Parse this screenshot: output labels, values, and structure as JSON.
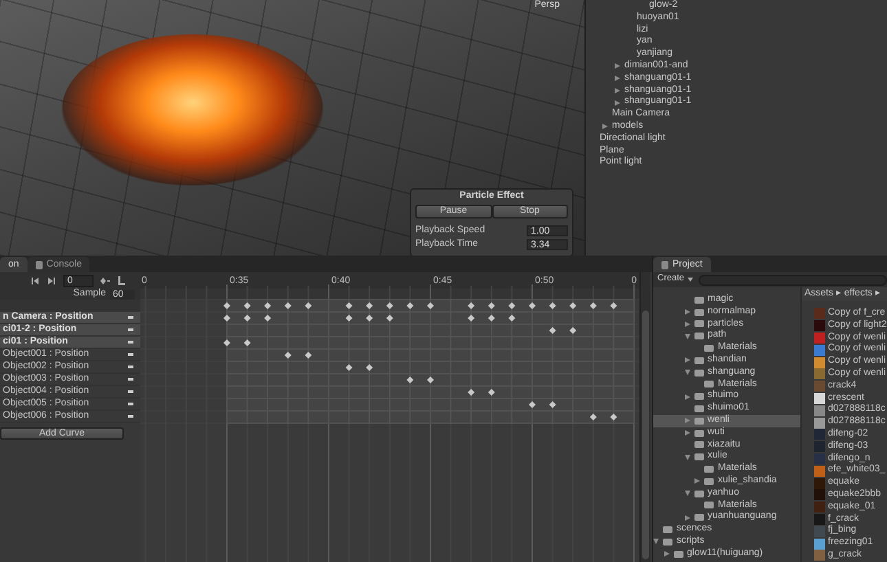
{
  "scene": {
    "view_label": "Persp"
  },
  "particle_effect": {
    "title": "Particle Effect",
    "buttons": [
      "Pause",
      "Stop"
    ],
    "fields": [
      {
        "label": "Playback Speed",
        "value": "1.00"
      },
      {
        "label": "Playback Time",
        "value": "3.34"
      }
    ]
  },
  "hierarchy": {
    "items": [
      {
        "children": [
          {
            "children": [
              {
                "children": [
                  {
                    "children": [
                      {
                        "label": "glow-2",
                        "selected": false
                      }
                    ]
                  },
                  {
                    "label": "huoyan01",
                    "selected": false
                  },
                  {
                    "label": "lizi",
                    "selected": false
                  },
                  {
                    "label": "yan",
                    "selected": false
                  },
                  {
                    "label": "yanjiang",
                    "selected": false
                  }
                ]
              },
              {
                "label": "dimian001-and",
                "expanded": false,
                "selected": false
              },
              {
                "label": "shanguang01-1",
                "expanded": false,
                "selected": false
              },
              {
                "label": "shanguang01-1",
                "expanded": false,
                "selected": false
              },
              {
                "label": "shanguang01-1",
                "expanded": false,
                "selected": false
              }
            ]
          },
          {
            "label": "Main Camera",
            "selected": false
          },
          {
            "label": "models",
            "expanded": false,
            "selected": false
          }
        ]
      },
      {
        "label": "Directional light",
        "selected": false
      },
      {
        "label": "Plane",
        "selected": false
      },
      {
        "label": "Point light",
        "selected": false
      }
    ]
  },
  "animation": {
    "tabs": [
      {
        "label": "on",
        "selected": true,
        "kind": "plain"
      },
      {
        "label": "Console",
        "selected": false,
        "kind": "console"
      }
    ],
    "frame": "0",
    "sample_label": "Sample",
    "sample": "60",
    "ruler": [
      "0",
      "0:35",
      "0:40",
      "0:45",
      "0:50",
      "0"
    ],
    "summary_keys": [
      true,
      true,
      true,
      true,
      true,
      false,
      true,
      true,
      true,
      true,
      true,
      false,
      true,
      true,
      true,
      true,
      true,
      true,
      true,
      true
    ],
    "tracks": [
      {
        "label": "n Camera : Position",
        "highlighted": true,
        "keys": [
          true,
          true,
          true,
          false,
          false,
          false,
          true,
          true,
          true,
          false,
          false,
          false,
          true,
          true,
          true,
          false,
          false,
          false,
          false,
          false
        ]
      },
      {
        "label": "ci01-2 : Position",
        "highlighted": true,
        "keys": [
          false,
          false,
          false,
          false,
          false,
          false,
          false,
          false,
          false,
          false,
          false,
          false,
          false,
          false,
          false,
          false,
          true,
          true,
          false,
          false
        ]
      },
      {
        "label": "ci01 : Position",
        "highlighted": true,
        "keys": [
          true,
          true,
          false,
          false,
          false,
          false,
          false,
          false,
          false,
          false,
          false,
          false,
          false,
          false,
          false,
          false,
          false,
          false,
          false,
          false
        ]
      },
      {
        "label": "Object001 : Position",
        "highlighted": false,
        "keys": [
          false,
          false,
          false,
          true,
          true,
          false,
          false,
          false,
          false,
          false,
          false,
          false,
          false,
          false,
          false,
          false,
          false,
          false,
          false,
          false
        ]
      },
      {
        "label": "Object002 : Position",
        "highlighted": false,
        "keys": [
          false,
          false,
          false,
          false,
          false,
          false,
          true,
          true,
          false,
          false,
          false,
          false,
          false,
          false,
          false,
          false,
          false,
          false,
          false,
          false
        ]
      },
      {
        "label": "Object003 : Position",
        "highlighted": false,
        "keys": [
          false,
          false,
          false,
          false,
          false,
          false,
          false,
          false,
          false,
          true,
          true,
          false,
          false,
          false,
          false,
          false,
          false,
          false,
          false,
          false
        ]
      },
      {
        "label": "Object004 : Position",
        "highlighted": false,
        "keys": [
          false,
          false,
          false,
          false,
          false,
          false,
          false,
          false,
          false,
          false,
          false,
          false,
          true,
          true,
          false,
          false,
          false,
          false,
          false,
          false
        ]
      },
      {
        "label": "Object005 : Position",
        "highlighted": false,
        "keys": [
          false,
          false,
          false,
          false,
          false,
          false,
          false,
          false,
          false,
          false,
          false,
          false,
          false,
          false,
          false,
          true,
          true,
          false,
          false,
          false
        ]
      },
      {
        "label": "Object006 : Position",
        "highlighted": false,
        "keys": [
          false,
          false,
          false,
          false,
          false,
          false,
          false,
          false,
          false,
          false,
          false,
          false,
          false,
          false,
          false,
          false,
          false,
          false,
          true,
          true
        ]
      }
    ],
    "add_curve": "Add Curve"
  },
  "project": {
    "tab": "Project",
    "create": "Create",
    "tree": [
      {
        "children": [
          {
            "children": [
              {
                "children": [
                  {
                    "label": "magic",
                    "selected": false
                  },
                  {
                    "label": "normalmap",
                    "expanded": false,
                    "selected": false
                  },
                  {
                    "label": "particles",
                    "expanded": false,
                    "selected": false
                  },
                  {
                    "label": "path",
                    "expanded": true,
                    "selected": false,
                    "children": [
                      {
                        "label": "Materials",
                        "selected": false
                      }
                    ]
                  },
                  {
                    "label": "shandian",
                    "expanded": false,
                    "selected": false
                  },
                  {
                    "label": "shanguang",
                    "expanded": true,
                    "selected": false,
                    "children": [
                      {
                        "label": "Materials",
                        "selected": false
                      }
                    ]
                  },
                  {
                    "label": "shuimo",
                    "expanded": false,
                    "selected": false
                  },
                  {
                    "label": "shuimo01",
                    "selected": false
                  },
                  {
                    "label": "wenli",
                    "expanded": false,
                    "selected": true
                  },
                  {
                    "label": "wuti",
                    "expanded": false,
                    "selected": false
                  },
                  {
                    "label": "xiazaitu",
                    "selected": false
                  },
                  {
                    "label": "xulie",
                    "expanded": true,
                    "selected": false,
                    "children": [
                      {
                        "label": "Materials",
                        "selected": false
                      },
                      {
                        "label": "xulie_shandia",
                        "expanded": false,
                        "selected": false
                      }
                    ]
                  },
                  {
                    "label": "yanhuo",
                    "expanded": true,
                    "selected": false,
                    "children": [
                      {
                        "label": "Materials",
                        "selected": false
                      }
                    ]
                  },
                  {
                    "label": "yuanhuanguang",
                    "expanded": false,
                    "selected": false
                  }
                ]
              }
            ]
          }
        ]
      },
      {
        "label": "scences",
        "selected": false
      },
      {
        "label": "scripts",
        "expanded": true,
        "selected": false,
        "children": [
          {
            "label": "glow11(huiguang)",
            "expanded": false,
            "selected": false
          }
        ]
      }
    ],
    "breadcrumb": "Assets ▸ effects ▸",
    "assets": [
      {
        "name": "Copy of f_cre",
        "color": "#5a2a1a"
      },
      {
        "name": "Copy of light2",
        "color": "#2a0a0a"
      },
      {
        "name": "Copy of wenli",
        "color": "#c02020"
      },
      {
        "name": "Copy of wenli",
        "color": "#3a7ad0"
      },
      {
        "name": "Copy of wenli",
        "color": "#d08a30"
      },
      {
        "name": "Copy of wenli",
        "color": "#8a6a30"
      },
      {
        "name": "crack4",
        "color": "#6a4a30"
      },
      {
        "name": "crescent",
        "color": "#d8d8d8"
      },
      {
        "name": "d027888118c",
        "color": "#888888"
      },
      {
        "name": "d027888118c",
        "color": "#999999"
      },
      {
        "name": "difeng-02",
        "color": "#202838"
      },
      {
        "name": "difeng-03",
        "color": "#1e2430"
      },
      {
        "name": "difengo_n",
        "color": "#283048"
      },
      {
        "name": "efe_white03_",
        "color": "#c06018"
      },
      {
        "name": "equake",
        "color": "#301808"
      },
      {
        "name": "equake2bbb",
        "color": "#201008"
      },
      {
        "name": "equake_01",
        "color": "#402010"
      },
      {
        "name": "f_crack",
        "color": "#181818"
      },
      {
        "name": "fj_bing",
        "color": "#404850"
      },
      {
        "name": "freezing01",
        "color": "#5aa0d0"
      },
      {
        "name": "g_crack",
        "color": "#806040"
      }
    ]
  }
}
